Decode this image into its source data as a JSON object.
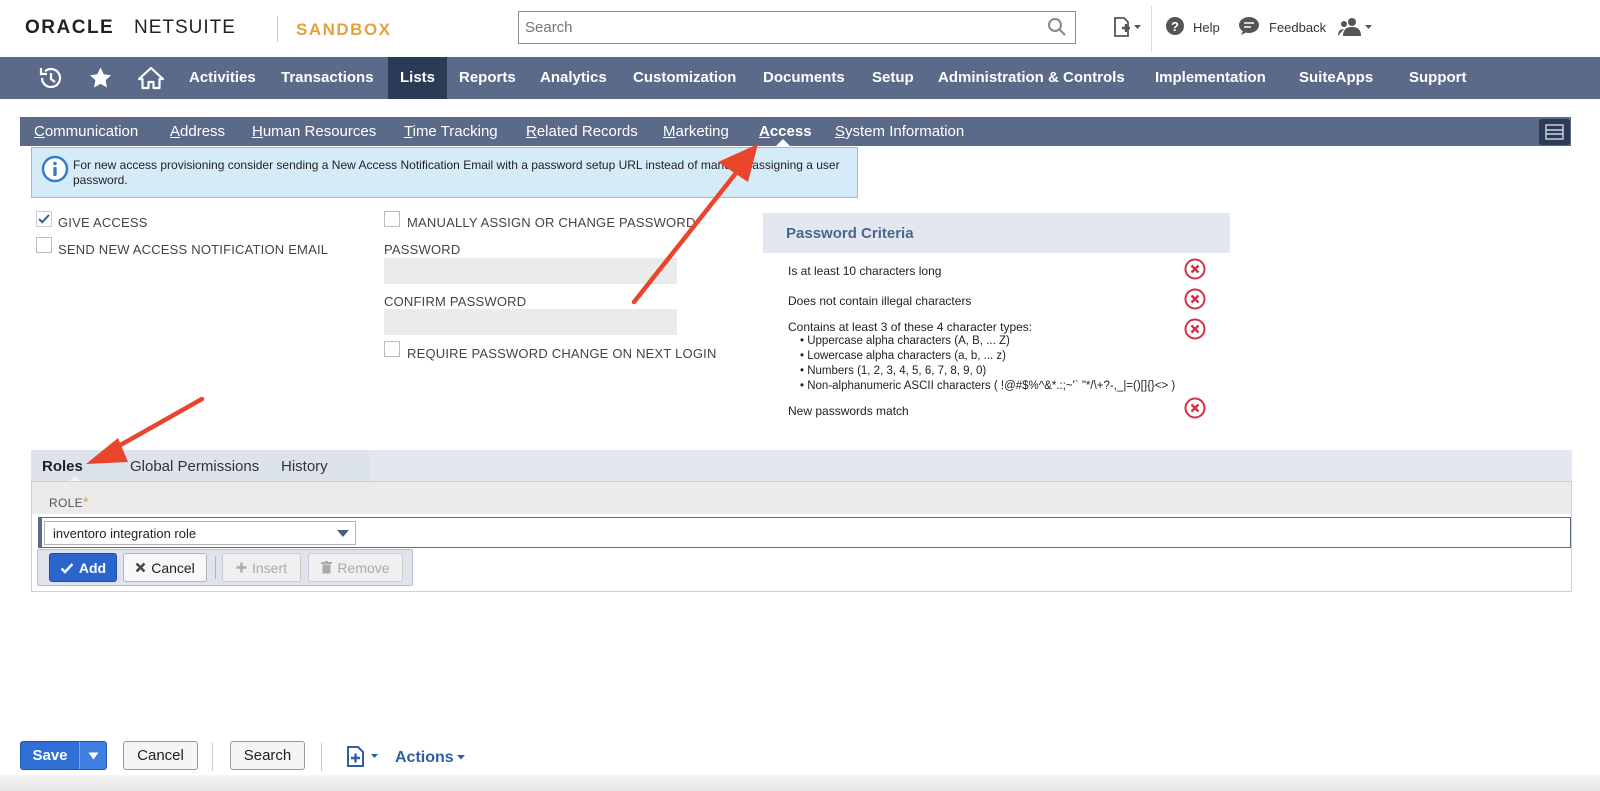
{
  "header": {
    "logo_oracle": "ORACLE",
    "logo_netsuite": "NETSUITE",
    "environment": "SANDBOX",
    "search_placeholder": "Search",
    "help_label": "Help",
    "feedback_label": "Feedback"
  },
  "mainnav": {
    "items": [
      "Activities",
      "Transactions",
      "Lists",
      "Reports",
      "Analytics",
      "Customization",
      "Documents",
      "Setup",
      "Administration & Controls",
      "Implementation",
      "SuiteApps",
      "Support"
    ],
    "active": "Lists"
  },
  "subtabs": {
    "items": [
      {
        "first": "C",
        "rest": "ommunication"
      },
      {
        "first": "A",
        "rest": "ddress"
      },
      {
        "first": "H",
        "rest": "uman Resources"
      },
      {
        "first": "T",
        "rest": "ime Tracking"
      },
      {
        "first": "R",
        "rest": "elated Records"
      },
      {
        "first": "M",
        "rest": "arketing"
      },
      {
        "first": "A",
        "rest": "ccess"
      },
      {
        "first": "S",
        "rest": "ystem Information"
      }
    ],
    "active": "Access"
  },
  "banner": {
    "text": "For new access provisioning consider sending a New Access Notification Email with a password setup URL instead of manually assigning a user password."
  },
  "form": {
    "give_access_label": "GIVE ACCESS",
    "give_access_checked": true,
    "send_email_label": "SEND NEW ACCESS NOTIFICATION EMAIL",
    "manual_password_label": "MANUALLY ASSIGN OR CHANGE PASSWORD",
    "password_label": "PASSWORD",
    "confirm_password_label": "CONFIRM PASSWORD",
    "require_change_label": "REQUIRE PASSWORD CHANGE ON NEXT LOGIN"
  },
  "criteria": {
    "title": "Password Criteria",
    "rules": [
      "Is at least 10 characters long",
      "Does not contain illegal characters",
      "Contains at least 3 of these 4 character types:",
      "New passwords match"
    ],
    "types": [
      "• Uppercase alpha characters (A, B, ... Z)",
      "• Lowercase alpha characters (a, b, ... z)",
      "• Numbers (1, 2, 3, 4, 5, 6, 7, 8, 9, 0)",
      "• Non-alphanumeric ASCII characters ( !@#$%^&*.:;~'` \"*/\\+?-,_|=()[]{}<> )"
    ]
  },
  "roles": {
    "tabs": [
      "Roles",
      "Global Permissions",
      "History"
    ],
    "active_tab": "Roles",
    "column_header": "ROLE",
    "selected_role": "inventoro integration role",
    "buttons": {
      "add": "Add",
      "cancel": "Cancel",
      "insert": "Insert",
      "remove": "Remove"
    }
  },
  "toolbar": {
    "save": "Save",
    "cancel": "Cancel",
    "search": "Search",
    "actions": "Actions"
  },
  "colors": {
    "nav": "#5a6a88",
    "nav_active": "#2b3b56",
    "primary": "#2965cc",
    "sandbox": "#e8a13a",
    "annotation_arrow": "#e8452c",
    "error_icon": "#d0304a"
  }
}
